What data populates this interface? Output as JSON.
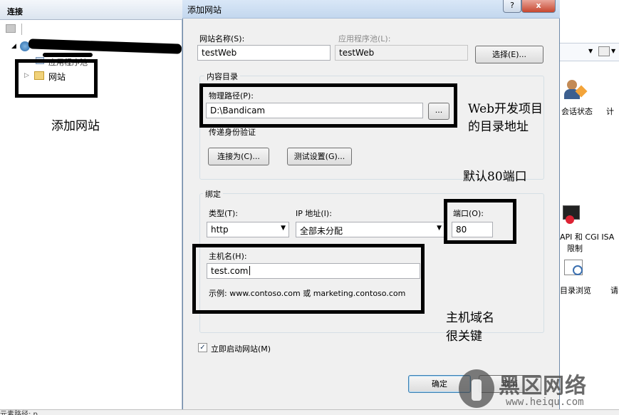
{
  "left_pane": {
    "header": "连接",
    "tree": {
      "app_pool": "应用程序池",
      "sites": "网站"
    }
  },
  "right_pane": {
    "icons": [
      {
        "label": "会话状态",
        "icon": "session-state-icon"
      },
      {
        "label": "计",
        "icon": "partial-icon"
      },
      {
        "label": "API 和 CGI ISA",
        "icon": "cgi-restrictions-icon"
      },
      {
        "label": "限制",
        "icon": ""
      },
      {
        "label": "目录浏览",
        "icon": "directory-browsing-icon"
      },
      {
        "label": "请",
        "icon": ""
      }
    ]
  },
  "dialog": {
    "title": "添加网站",
    "help_label": "?",
    "close_label": "x",
    "site_name_label": "网站名称(S):",
    "site_name_value": "testWeb",
    "app_pool_label": "应用程序池(L):",
    "app_pool_value": "testWeb",
    "select_button": "选择(E)...",
    "content_dir_label": "内容目录",
    "physical_path_label": "物理路径(P):",
    "physical_path_value": "D:\\Bandicam",
    "browse_button": "...",
    "pass_through_label": "传递身份验证",
    "connect_as_button": "连接为(C)...",
    "test_settings_button": "测试设置(G)...",
    "binding_label": "绑定",
    "type_label": "类型(T):",
    "type_value": "http",
    "ip_label": "IP 地址(I):",
    "ip_value": "全部未分配",
    "port_label": "端口(O):",
    "port_value": "80",
    "host_label": "主机名(H):",
    "host_value": "test.com",
    "example_text": "示例: www.contoso.com 或 marketing.contoso.com",
    "start_checkbox_label": "立即启动网站(M)",
    "start_checked": true,
    "ok_button": "确定",
    "cancel_button": "取消"
  },
  "annotations": {
    "add_site": "添加网站",
    "web_dir_line1": "Web开发项目",
    "web_dir_line2": "的目录地址",
    "default_port": "默认80端口",
    "host_line1": "主机域名",
    "host_line2": "很关键"
  },
  "status": {
    "text": "元素路径: p"
  },
  "watermark": {
    "brand": "黑区网络",
    "url": "www.heiqu.com"
  }
}
